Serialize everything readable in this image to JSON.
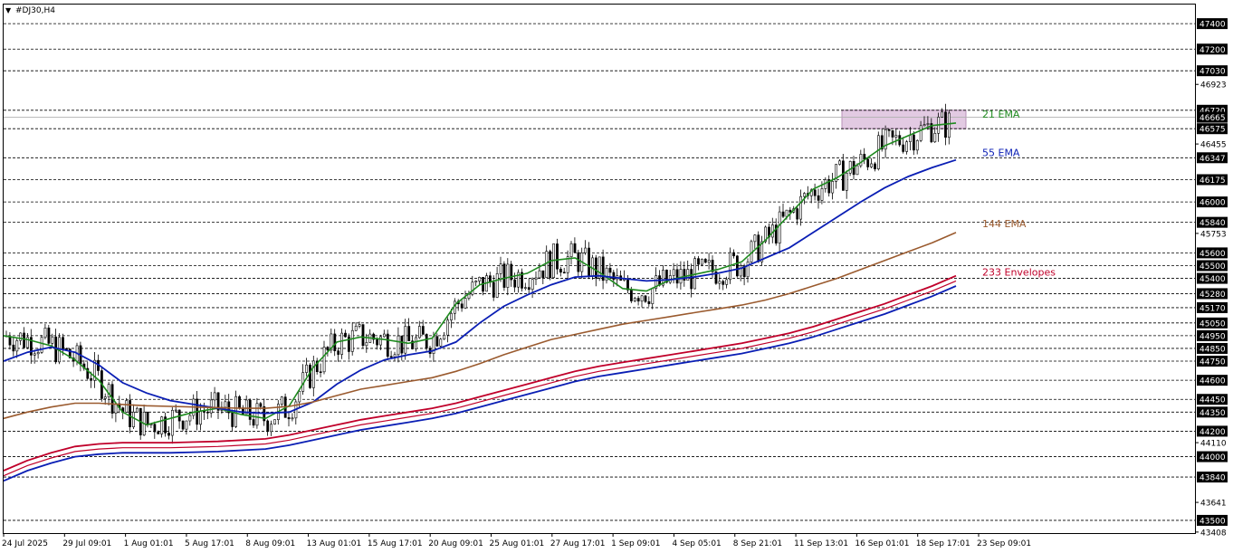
{
  "header": {
    "symbol_label": "#DJ30,H4"
  },
  "colors": {
    "background": "#ffffff",
    "grid_dash": "#000000",
    "candle": "#000000",
    "ema21": "#1e8a1e",
    "ema55": "#0a1eb4",
    "ema144": "#9a5a2e",
    "env_upper": "#c0002a",
    "env_lower": "#0a1eb4",
    "zone_fill": "#d8b8d8",
    "price_label_bg": "#000000",
    "price_label_fg": "#ffffff"
  },
  "chart_data": {
    "type": "line",
    "symbol": "#DJ30",
    "timeframe": "H4",
    "ylim": [
      43400,
      47550
    ],
    "x_tick_labels": [
      "24 Jul 2025",
      "29 Jul 09:01",
      "1 Aug 01:01",
      "5 Aug 17:01",
      "8 Aug 09:01",
      "13 Aug 01:01",
      "15 Aug 17:01",
      "20 Aug 09:01",
      "25 Aug 01:01",
      "27 Aug 17:01",
      "1 Sep 09:01",
      "4 Sep 05:01",
      "8 Sep 21:01",
      "11 Sep 13:01",
      "16 Sep 01:01",
      "18 Sep 17:01",
      "23 Sep 09:01"
    ],
    "level_labels": [
      47400,
      47200,
      47030,
      46720,
      46665,
      46575,
      46347,
      46175,
      46000,
      45840,
      45600,
      45500,
      45400,
      45280,
      45170,
      45050,
      44950,
      44850,
      44750,
      44600,
      44450,
      44350,
      44200,
      44000,
      43840,
      43500
    ],
    "plain_ticks": [
      46923,
      46455,
      45753,
      44110,
      43641,
      43408
    ],
    "resistance_zone": [
      46575,
      46720
    ],
    "last_price": 46665,
    "series": [
      {
        "name": "21 EMA",
        "values": [
          44950,
          44920,
          44870,
          44760,
          44600,
          44350,
          44250,
          44300,
          44350,
          44380,
          44330,
          44300,
          44400,
          44700,
          44900,
          44940,
          44920,
          44890,
          44930,
          45200,
          45350,
          45400,
          45440,
          45540,
          45560,
          45450,
          45320,
          45300,
          45390,
          45430,
          45470,
          45530,
          45700,
          45900,
          46100,
          46190,
          46310,
          46440,
          46520,
          46600,
          46620
        ]
      },
      {
        "name": "55 EMA",
        "values": [
          44750,
          44820,
          44860,
          44820,
          44720,
          44580,
          44500,
          44440,
          44410,
          44380,
          44350,
          44340,
          44350,
          44430,
          44570,
          44680,
          44760,
          44800,
          44830,
          44900,
          45050,
          45180,
          45270,
          45350,
          45410,
          45420,
          45400,
          45380,
          45390,
          45410,
          45440,
          45480,
          45560,
          45640,
          45760,
          45880,
          46000,
          46110,
          46200,
          46270,
          46330
        ]
      },
      {
        "name": "144 EMA",
        "values": [
          44300,
          44350,
          44390,
          44420,
          44420,
          44410,
          44400,
          44395,
          44390,
          44385,
          44380,
          44380,
          44395,
          44430,
          44480,
          44530,
          44560,
          44590,
          44620,
          44670,
          44730,
          44800,
          44860,
          44920,
          44960,
          45000,
          45040,
          45070,
          45100,
          45130,
          45160,
          45190,
          45230,
          45280,
          45340,
          45400,
          45470,
          45540,
          45610,
          45680,
          45760
        ]
      },
      {
        "name": "233 Envelopes",
        "values": [
          43890,
          43970,
          44030,
          44080,
          44100,
          44110,
          44110,
          44110,
          44115,
          44120,
          44130,
          44140,
          44170,
          44210,
          44250,
          44290,
          44320,
          44350,
          44380,
          44420,
          44470,
          44520,
          44570,
          44620,
          44670,
          44710,
          44740,
          44770,
          44800,
          44830,
          44860,
          44890,
          44930,
          44970,
          45020,
          45080,
          45140,
          45200,
          45270,
          45340,
          45420
        ]
      },
      {
        "name": "",
        "values": [
          43850,
          43930,
          43990,
          44040,
          44060,
          44070,
          44070,
          44070,
          44075,
          44080,
          44090,
          44100,
          44130,
          44170,
          44210,
          44250,
          44280,
          44310,
          44340,
          44380,
          44430,
          44480,
          44530,
          44580,
          44630,
          44670,
          44700,
          44730,
          44760,
          44790,
          44820,
          44850,
          44890,
          44930,
          44980,
          45040,
          45100,
          45160,
          45230,
          45300,
          45380
        ]
      },
      {
        "name": "",
        "values": [
          43810,
          43890,
          43950,
          44000,
          44020,
          44030,
          44030,
          44030,
          44035,
          44040,
          44050,
          44060,
          44090,
          44130,
          44170,
          44210,
          44240,
          44270,
          44300,
          44340,
          44390,
          44440,
          44490,
          44540,
          44590,
          44630,
          44660,
          44690,
          44720,
          44750,
          44780,
          44810,
          44850,
          44890,
          44940,
          45000,
          45060,
          45120,
          45190,
          45260,
          45340
        ]
      }
    ]
  }
}
